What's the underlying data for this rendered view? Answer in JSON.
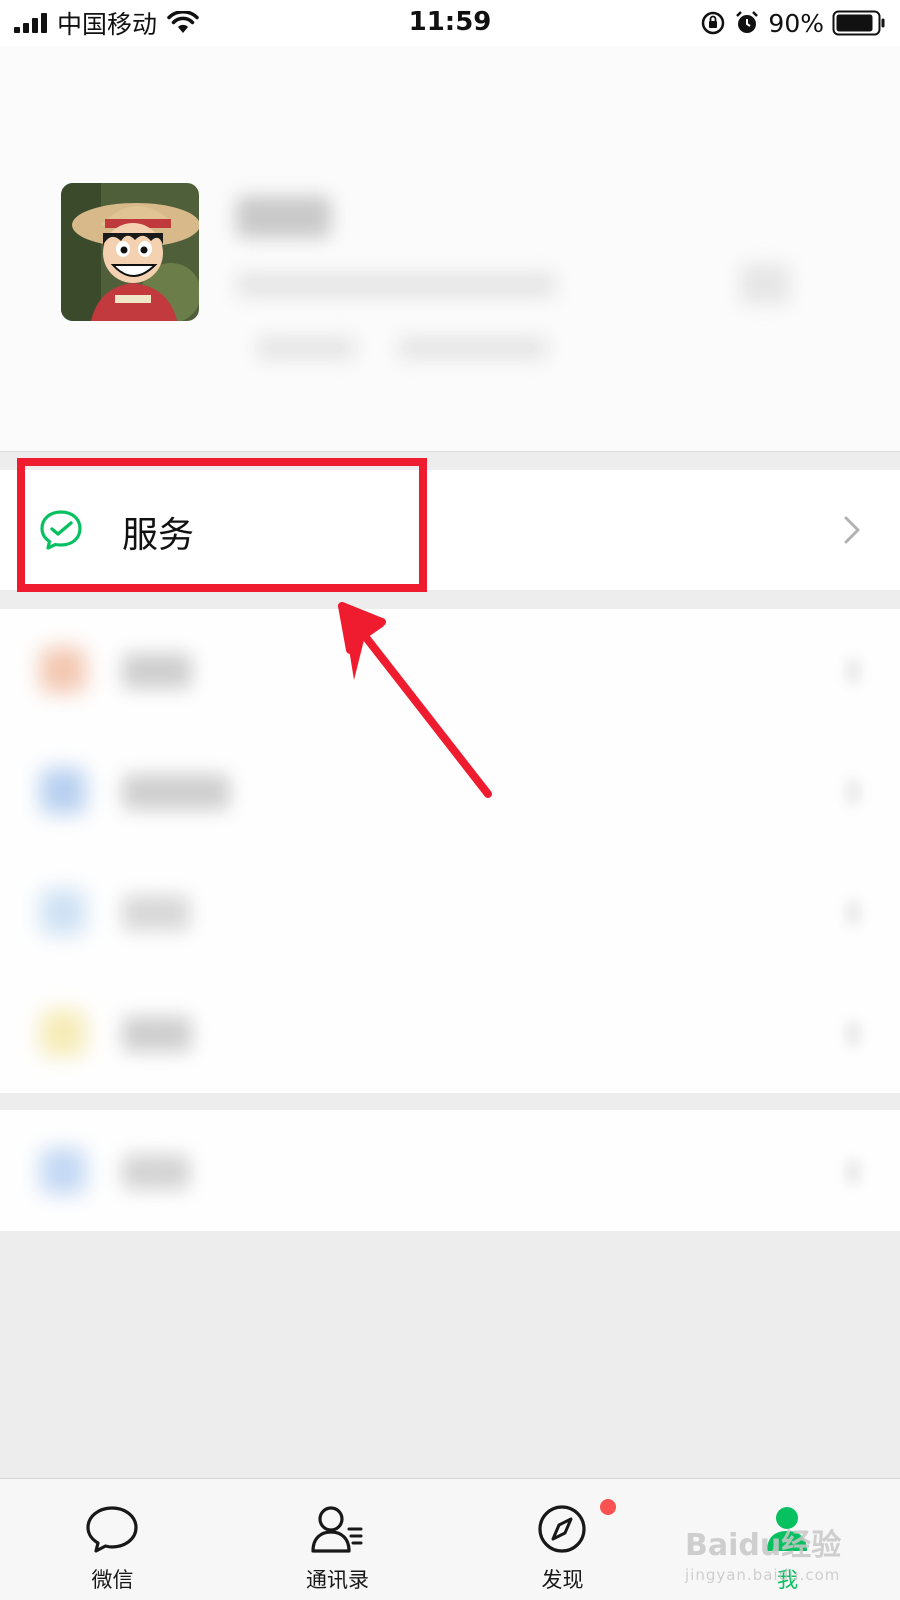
{
  "status_bar": {
    "carrier": "中国移动",
    "time": "11:59",
    "battery_percent": "90%",
    "battery_level": 0.9
  },
  "profile": {
    "avatar_icon": "profile-avatar-image"
  },
  "service": {
    "label": "服务",
    "icon": "wechat-pay-check-icon",
    "icon_color": "#07c160"
  },
  "annotation": {
    "color": "#ee1c2e"
  },
  "tabs": [
    {
      "label": "微信",
      "icon": "chat-bubble-icon",
      "active": false
    },
    {
      "label": "通讯录",
      "icon": "contacts-icon",
      "active": false
    },
    {
      "label": "发现",
      "icon": "compass-icon",
      "active": false,
      "badge": true
    },
    {
      "label": "我",
      "icon": "me-person-icon",
      "active": true
    }
  ],
  "watermark": {
    "brand": "Baidu经验",
    "url": "jingyan.baidu.com"
  },
  "colors": {
    "accent": "#07c160",
    "badge": "#fa5151"
  }
}
